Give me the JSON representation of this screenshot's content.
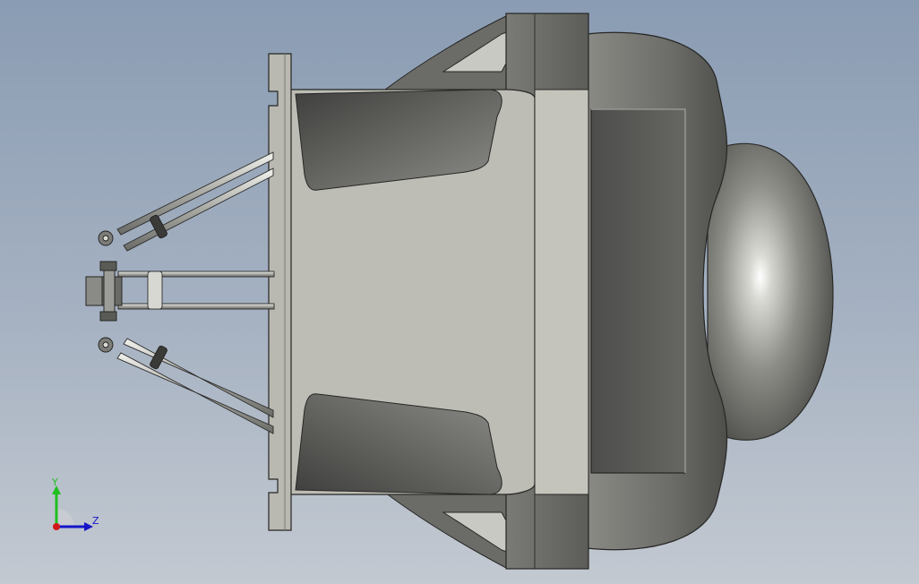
{
  "viewport": {
    "background_top": "#8a9cb3",
    "background_bottom": "#c3c9d1"
  },
  "model": {
    "shell_color": "#6e6e6a",
    "housing_color": "#bdbdb5",
    "dark_panel_color": "#5a5a57"
  },
  "triad": {
    "y_label": "Y",
    "z_label": "Z",
    "y_color": "#1fbf1f",
    "z_color": "#1414c8",
    "x_color": "#d01818"
  }
}
